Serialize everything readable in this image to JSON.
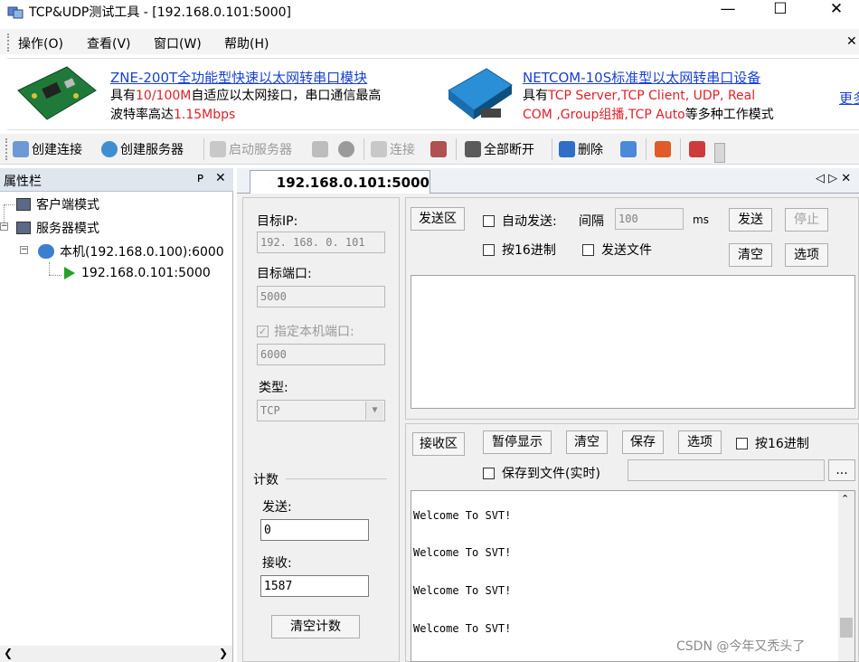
{
  "window": {
    "title": "TCP&UDP测试工具 - [192.168.0.101:5000]",
    "minimize": "—",
    "maximize": "☐",
    "close": "✕"
  },
  "menu": {
    "items": [
      "操作(O)",
      "查看(V)",
      "窗口(W)",
      "帮助(H)"
    ],
    "close": "✕"
  },
  "ads": {
    "ad1": {
      "link": "ZNE-200T全功能型快速以太网转串口模块",
      "line1_a": "具有",
      "line1_red": "10/100M",
      "line1_b": "自适应以太网接口，串口通信最高",
      "line2_a": "波特率高达",
      "line2_red": "1.15Mbps"
    },
    "ad2": {
      "link": "NETCOM-10S标准型以太网转串口设备",
      "line1_a": "具有",
      "line1_red": "TCP Server,TCP Client, UDP, Real",
      "line2_red": "COM ,Group组播,TCP Auto",
      "line2_b": "等多种工作模式"
    },
    "more": "更多"
  },
  "toolbar": {
    "create_connection": "创建连接",
    "create_server": "创建服务器",
    "start_server": "启动服务器",
    "connect": "连接",
    "disconnect_all": "全部断开",
    "delete": "删除"
  },
  "sidebar": {
    "title": "属性栏",
    "pin": "ᴘ",
    "close": "✕",
    "client_mode": "客户端模式",
    "server_mode": "服务器模式",
    "local_host": "本机(192.168.0.100):6000",
    "connection": "192.168.0.101:5000"
  },
  "tab": {
    "label": "192.168.0.101:5000",
    "nav": "◁ ▷ ✕"
  },
  "left_form": {
    "target_ip_label": "目标IP:",
    "target_ip": "192. 168. 0. 101",
    "target_port_label": "目标端口:",
    "target_port": "5000",
    "local_port_label": "指定本机端口:",
    "local_port": "6000",
    "type_label": "类型:",
    "type_value": "TCP",
    "count_label": "计数",
    "send_label": "发送:",
    "send_count": "0",
    "recv_label": "接收:",
    "recv_count": "1587",
    "clear_count": "清空计数"
  },
  "send_area": {
    "label": "发送区",
    "auto_send": "自动发送:",
    "interval_label": "间隔",
    "interval_value": "100",
    "ms": "ms",
    "send_btn": "发送",
    "stop_btn": "停止",
    "hex16": "按16进制",
    "send_file": "发送文件",
    "clear_btn": "清空",
    "options_btn": "选项"
  },
  "recv_area": {
    "label": "接收区",
    "pause": "暂停显示",
    "clear": "清空",
    "save": "保存",
    "options": "选项",
    "hex16": "按16进制",
    "save_file": "保存到文件(实时)",
    "browse": "...",
    "lines": [
      "Welcome To SVT!",
      "Welcome To SVT!",
      "Welcome To SVT!",
      "Welcome To SVT!"
    ]
  },
  "watermark": "CSDN @今年又秃头了",
  "colors": {
    "link": "#1a40d6",
    "accent_red": "#e0202a",
    "tab_bg": "#eef1f5"
  }
}
